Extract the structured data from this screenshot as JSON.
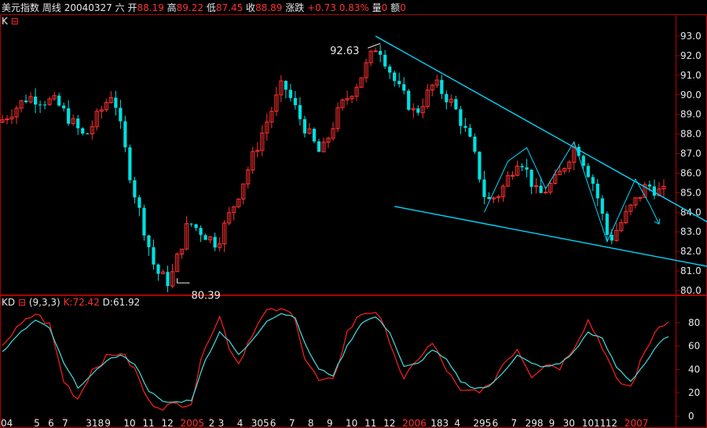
{
  "header": {
    "name": "美元指数",
    "period": "周线",
    "date": "20040327",
    "weekday": "六",
    "open_label": "开",
    "open": "88.19",
    "high_label": "高",
    "high": "89.22",
    "low_label": "低",
    "low": "87.45",
    "close_label": "收",
    "close": "88.89",
    "change_label": "涨跌",
    "change": "+0.73",
    "change_pct": "0.83%",
    "vol_label": "量",
    "vol": "0",
    "amount_label": "额",
    "amount": "0"
  },
  "k_panel": {
    "label": "K",
    "marker": "⊟"
  },
  "kd_panel": {
    "label": "KD",
    "marker": "⊟",
    "params": "(9,3,3)",
    "k_text": "K:72.42",
    "d_text": "D:61.92"
  },
  "colors": {
    "up": "#ff3030",
    "down": "#00e0e0",
    "trend": "#00d8ff",
    "axis": "#b00000",
    "k": "#ff2020",
    "d": "#40e0e0",
    "text": "#e8e8e8"
  },
  "chart_data": [
    {
      "type": "candlestick",
      "title": "",
      "ylim": [
        80.0,
        93.0
      ],
      "yticks": [
        "93.0",
        "92.0",
        "91.0",
        "90.0",
        "89.0",
        "88.0",
        "87.0",
        "86.0",
        "85.0",
        "84.0",
        "83.0",
        "82.0",
        "81.0",
        "80.0"
      ],
      "annotations": [
        {
          "text": "92.63",
          "x": 80,
          "y": 92.63
        },
        {
          "text": "80.39",
          "x": 37,
          "y": 80.39
        }
      ],
      "guide": [
        [
          0,
          88.6
        ],
        [
          6,
          89.9
        ],
        [
          12,
          89.6
        ],
        [
          18,
          87.8
        ],
        [
          24,
          90.2
        ],
        [
          28,
          85.5
        ],
        [
          33,
          81.0
        ],
        [
          36,
          80.39
        ],
        [
          40,
          83.5
        ],
        [
          46,
          82.4
        ],
        [
          50,
          84.6
        ],
        [
          56,
          88.3
        ],
        [
          60,
          90.6
        ],
        [
          64,
          88.6
        ],
        [
          68,
          86.9
        ],
        [
          72,
          89.3
        ],
        [
          76,
          90.7
        ],
        [
          80,
          92.63
        ],
        [
          84,
          90.5
        ],
        [
          88,
          89.0
        ],
        [
          92,
          90.6
        ],
        [
          96,
          89.5
        ],
        [
          100,
          87.4
        ],
        [
          103,
          84.5
        ],
        [
          106,
          85.0
        ],
        [
          110,
          86.9
        ],
        [
          114,
          84.8
        ],
        [
          118,
          85.7
        ],
        [
          122,
          87.5
        ],
        [
          126,
          85.3
        ],
        [
          129,
          82.5
        ],
        [
          133,
          84.0
        ],
        [
          137,
          85.4
        ],
        [
          140,
          85.0
        ]
      ],
      "trendlines": [
        {
          "from": [
            79,
            93.0
          ],
          "to": [
            150,
            83.4
          ]
        },
        {
          "from": [
            83,
            84.3
          ],
          "to": [
            150,
            81.2
          ]
        }
      ],
      "zigzag": [
        [
          102,
          84.0
        ],
        [
          107,
          86.6
        ],
        [
          111,
          87.3
        ],
        [
          115,
          85.2
        ],
        [
          121,
          87.6
        ],
        [
          128,
          82.5
        ],
        [
          134,
          85.7
        ],
        [
          137,
          84.4
        ],
        [
          139,
          83.4
        ]
      ],
      "xticks": [
        {
          "label": "04",
          "x": 0
        },
        {
          "label": "5",
          "x": 7
        },
        {
          "label": "6",
          "x": 10
        },
        {
          "label": "7",
          "x": 13
        },
        {
          "label": "318",
          "x": 18
        },
        {
          "label": "9",
          "x": 22
        },
        {
          "label": "10",
          "x": 26
        },
        {
          "label": "11",
          "x": 30
        },
        {
          "label": "12",
          "x": 34
        },
        {
          "label": "2005",
          "x": 38
        },
        {
          "label": "2",
          "x": 44
        },
        {
          "label": "3",
          "x": 46
        },
        {
          "label": "4",
          "x": 50
        },
        {
          "label": "305",
          "x": 53
        },
        {
          "label": "6",
          "x": 57
        },
        {
          "label": "7",
          "x": 61
        },
        {
          "label": "8",
          "x": 65
        },
        {
          "label": "9",
          "x": 69
        },
        {
          "label": "10",
          "x": 73
        },
        {
          "label": "11",
          "x": 77
        },
        {
          "label": "12",
          "x": 81
        },
        {
          "label": "2006",
          "x": 85
        },
        {
          "label": "183",
          "x": 91
        },
        {
          "label": "4",
          "x": 96
        },
        {
          "label": "295",
          "x": 100
        },
        {
          "label": "6",
          "x": 104
        },
        {
          "label": "7",
          "x": 108
        },
        {
          "label": "298",
          "x": 111
        },
        {
          "label": "9",
          "x": 116
        },
        {
          "label": "30",
          "x": 119
        },
        {
          "label": "1011",
          "x": 123
        },
        {
          "label": "12",
          "x": 128
        },
        {
          "label": "2007",
          "x": 132
        }
      ]
    },
    {
      "type": "line",
      "title": "",
      "ylim": [
        0,
        90
      ],
      "yticks": [
        "80",
        "60",
        "40",
        "20",
        "0"
      ],
      "series": [
        {
          "name": "K",
          "guide": [
            [
              0,
              62
            ],
            [
              4,
              78
            ],
            [
              7,
              88
            ],
            [
              10,
              78
            ],
            [
              13,
              30
            ],
            [
              16,
              15
            ],
            [
              19,
              40
            ],
            [
              22,
              50
            ],
            [
              25,
              55
            ],
            [
              28,
              40
            ],
            [
              31,
              12
            ],
            [
              34,
              8
            ],
            [
              37,
              10
            ],
            [
              40,
              12
            ],
            [
              43,
              62
            ],
            [
              46,
              85
            ],
            [
              48,
              60
            ],
            [
              50,
              45
            ],
            [
              53,
              72
            ],
            [
              56,
              90
            ],
            [
              59,
              92
            ],
            [
              62,
              85
            ],
            [
              64,
              50
            ],
            [
              67,
              30
            ],
            [
              70,
              30
            ],
            [
              73,
              72
            ],
            [
              76,
              88
            ],
            [
              79,
              90
            ],
            [
              82,
              65
            ],
            [
              85,
              30
            ],
            [
              88,
              50
            ],
            [
              91,
              62
            ],
            [
              94,
              40
            ],
            [
              97,
              20
            ],
            [
              100,
              22
            ],
            [
              103,
              24
            ],
            [
              106,
              45
            ],
            [
              109,
              58
            ],
            [
              112,
              35
            ],
            [
              115,
              45
            ],
            [
              118,
              42
            ],
            [
              121,
              60
            ],
            [
              124,
              82
            ],
            [
              127,
              60
            ],
            [
              130,
              30
            ],
            [
              133,
              25
            ],
            [
              136,
              55
            ],
            [
              139,
              79
            ],
            [
              141,
              80
            ]
          ]
        },
        {
          "name": "D",
          "guide": [
            [
              0,
              55
            ],
            [
              4,
              72
            ],
            [
              7,
              82
            ],
            [
              10,
              75
            ],
            [
              13,
              45
            ],
            [
              16,
              25
            ],
            [
              19,
              35
            ],
            [
              22,
              48
            ],
            [
              25,
              52
            ],
            [
              28,
              45
            ],
            [
              31,
              22
            ],
            [
              34,
              12
            ],
            [
              37,
              12
            ],
            [
              40,
              14
            ],
            [
              43,
              48
            ],
            [
              46,
              72
            ],
            [
              48,
              65
            ],
            [
              50,
              52
            ],
            [
              53,
              65
            ],
            [
              56,
              82
            ],
            [
              59,
              88
            ],
            [
              62,
              85
            ],
            [
              64,
              62
            ],
            [
              67,
              40
            ],
            [
              70,
              35
            ],
            [
              73,
              60
            ],
            [
              76,
              80
            ],
            [
              79,
              85
            ],
            [
              82,
              72
            ],
            [
              85,
              42
            ],
            [
              88,
              45
            ],
            [
              91,
              57
            ],
            [
              94,
              48
            ],
            [
              97,
              30
            ],
            [
              100,
              24
            ],
            [
              103,
              25
            ],
            [
              106,
              38
            ],
            [
              109,
              52
            ],
            [
              112,
              45
            ],
            [
              115,
              42
            ],
            [
              118,
              45
            ],
            [
              121,
              55
            ],
            [
              124,
              72
            ],
            [
              127,
              66
            ],
            [
              130,
              42
            ],
            [
              133,
              30
            ],
            [
              136,
              45
            ],
            [
              139,
              62
            ],
            [
              141,
              69
            ]
          ]
        }
      ]
    }
  ]
}
